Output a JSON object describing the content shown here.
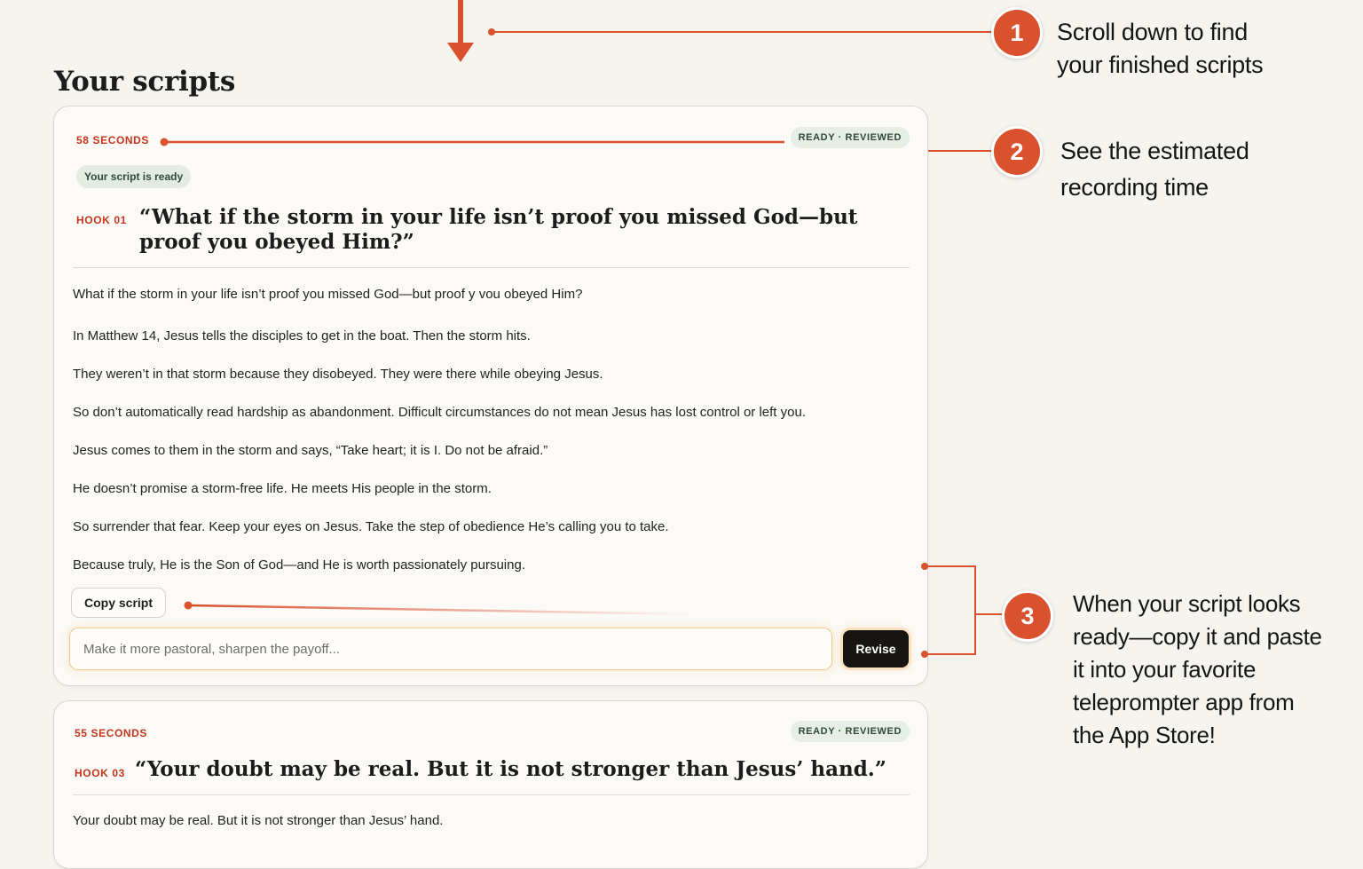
{
  "page": {
    "section_title": "Your scripts"
  },
  "script_cards": [
    {
      "duration": "58 SECONDS",
      "status": "READY · REVIEWED",
      "ready_label": "Your script is ready",
      "hook_label": "HOOK 01",
      "hook_title": "“What if the storm in your life isn’t proof you missed God—but proof you obeyed Him?”",
      "paragraphs": [
        "What if the storm in your life isn’t proof you missed God—but proof y vou obeyed Him?",
        "In Matthew 14, Jesus tells the disciples to get in the boat. Then the storm hits.",
        "They weren’t in that storm because they disobeyed. They were there while obeying Jesus.",
        "So don’t automatically read hardship as abandonment. Difficult circumstances do not mean Jesus has lost control or left you.",
        "Jesus comes to them in the storm and says, “Take heart; it is I. Do not be afraid.”",
        "He doesn’t promise a storm-free life. He meets His people in the storm.",
        "So surrender that fear. Keep your eyes on Jesus. Take the step of obedience He’s calling you to take.",
        "Because truly, He is the Son of God—and He is worth passionately pursuing."
      ],
      "copy_label": "Copy script",
      "revise_placeholder": "Make it more pastoral, sharpen the payoff...",
      "revise_value": "",
      "revise_label": "Revise"
    },
    {
      "duration": "55 SECONDS",
      "status": "READY · REVIEWED",
      "hook_label": "HOOK 03",
      "hook_title": "“Your doubt may be real. But it is not stronger than Jesus’ hand.”",
      "paragraphs": [
        "Your doubt may be real. But it is not stronger than Jesus’ hand."
      ]
    }
  ],
  "callouts": [
    {
      "number": "1",
      "lines": [
        "Scroll down to find",
        "your finished scripts"
      ]
    },
    {
      "number": "2",
      "lines": [
        "See the estimated",
        "recording time"
      ]
    },
    {
      "number": "3",
      "lines": [
        "When your script looks",
        "ready—copy it and paste",
        "it into your favorite",
        "teleprompter app from",
        "the App Store!"
      ]
    }
  ],
  "colors": {
    "accent": "#d9512d",
    "accent_text": "#c4361b",
    "background": "#f6f4ef",
    "card": "#fbfaf6",
    "status_pill": "#e7eee6",
    "button_dark": "#161512"
  },
  "icons": {
    "scroll_arrow": "arrow-down-icon"
  }
}
